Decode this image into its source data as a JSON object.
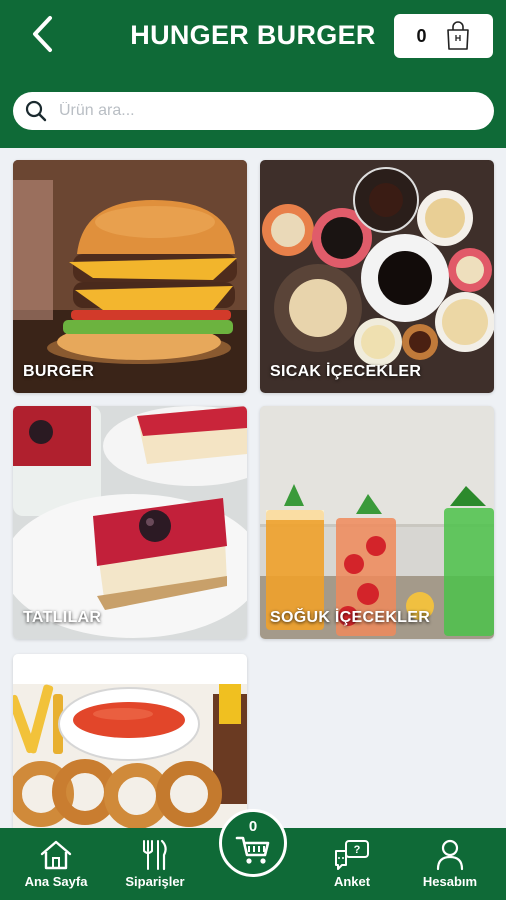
{
  "header": {
    "title": "HUNGER BURGER",
    "cart_count": "0"
  },
  "search": {
    "placeholder": "Ürün ara..."
  },
  "categories": [
    {
      "label": "BURGER"
    },
    {
      "label": "SICAK İÇECEKLER"
    },
    {
      "label": "TATLILAR"
    },
    {
      "label": "SOĞUK İÇECEKLER"
    },
    {
      "label": ""
    }
  ],
  "bottom_nav": {
    "home": "Ana Sayfa",
    "orders": "Siparişler",
    "cart_count": "0",
    "survey": "Anket",
    "account": "Hesabım"
  },
  "colors": {
    "brand_green": "#0f6a37",
    "background": "#eef1f5"
  },
  "icons": [
    "back-arrow-icon",
    "shopping-bag-icon",
    "search-icon",
    "home-icon",
    "fork-knife-icon",
    "cart-icon",
    "survey-chat-icon",
    "user-icon"
  ]
}
